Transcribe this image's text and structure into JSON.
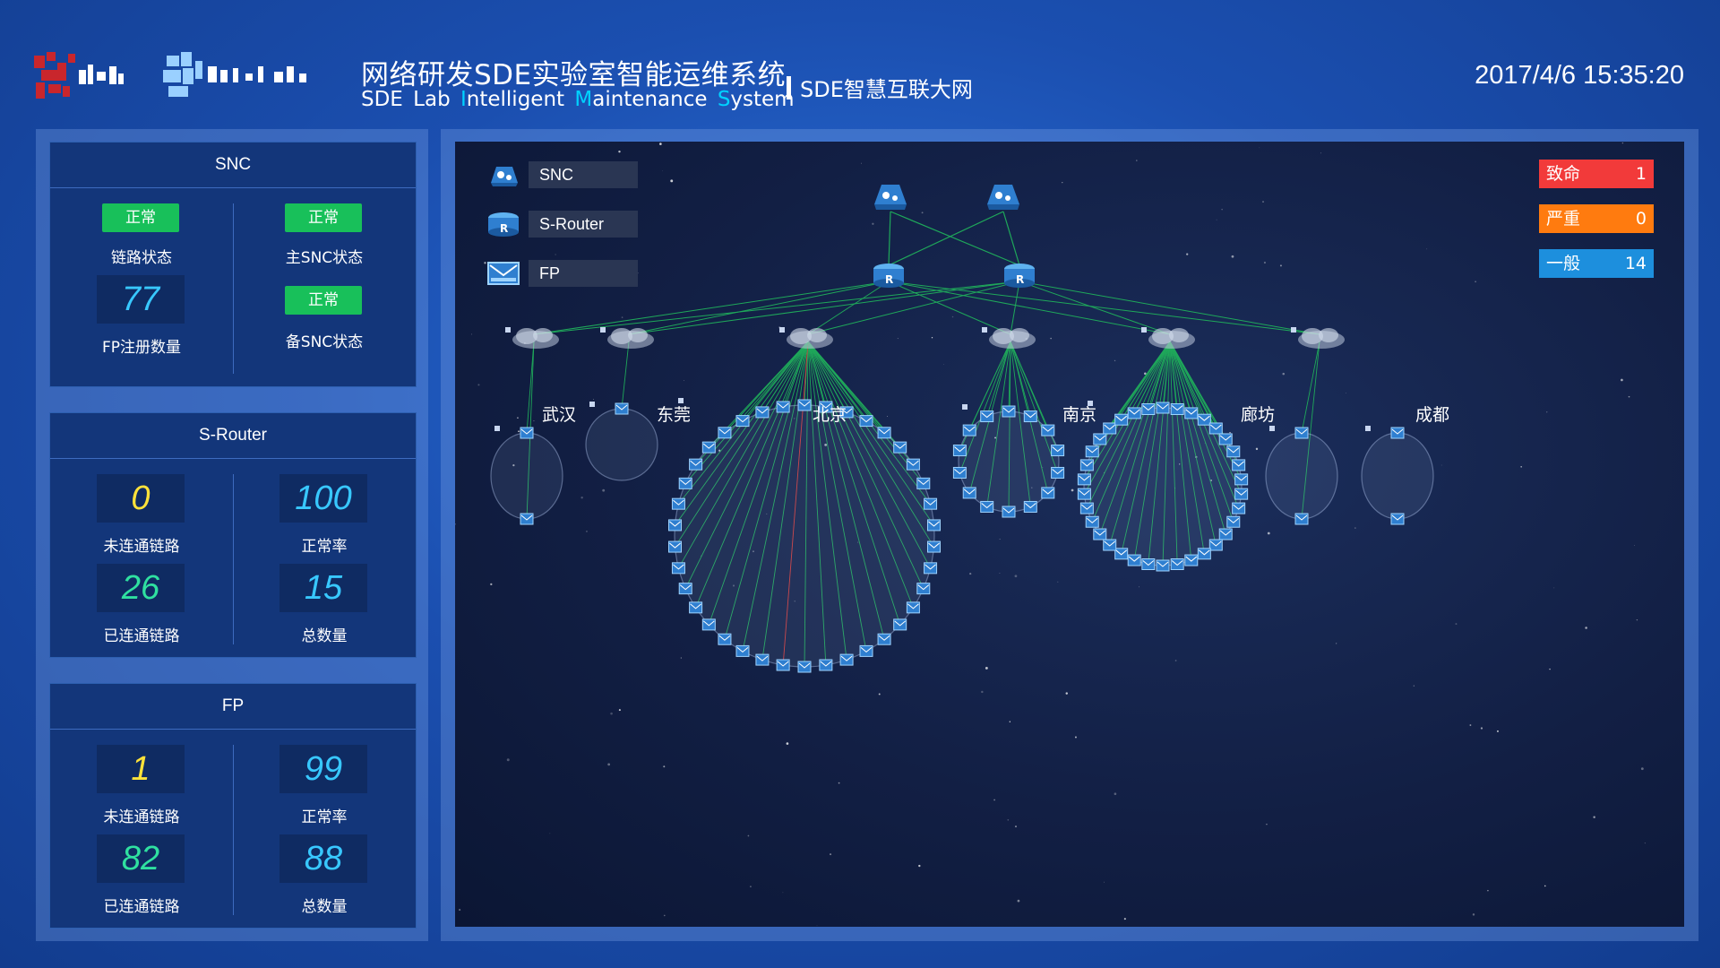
{
  "header": {
    "title_cn": "网络研发SDE实验室智能运维系统",
    "title_en_words": [
      {
        "cap": "",
        "rest": "SDE"
      },
      {
        "cap": "",
        "rest": "Lab"
      },
      {
        "cap": "I",
        "rest": "ntelligent"
      },
      {
        "cap": "M",
        "rest": "aintenance"
      },
      {
        "cap": "S",
        "rest": "ystem"
      }
    ],
    "subtitle": "SDE智慧互联大网",
    "datetime": "2017/4/6 15:35:20"
  },
  "snc_panel": {
    "title": "SNC",
    "link_status_badge": "正常",
    "link_status_label": "链路状态",
    "main_snc_badge": "正常",
    "main_snc_label": "主SNC状态",
    "fp_count": "77",
    "fp_count_label": "FP注册数量",
    "backup_snc_badge": "正常",
    "backup_snc_label": "备SNC状态"
  },
  "srouter_panel": {
    "title": "S-Router",
    "unconnected": "0",
    "unconnected_label": "未连通链路",
    "normal_rate": "100",
    "normal_rate_label": "正常率",
    "connected": "26",
    "connected_label": "已连通链路",
    "total": "15",
    "total_label": "总数量"
  },
  "fp_panel": {
    "title": "FP",
    "unconnected": "1",
    "unconnected_label": "未连通链路",
    "normal_rate": "99",
    "normal_rate_label": "正常率",
    "connected": "82",
    "connected_label": "已连通链路",
    "total": "88",
    "total_label": "总数量"
  },
  "legend": {
    "snc": "SNC",
    "srouter": "S-Router",
    "fp": "FP"
  },
  "alarms": {
    "fatal_label": "致命",
    "fatal_count": "1",
    "severe_label": "严重",
    "severe_count": "0",
    "general_label": "一般",
    "general_count": "14"
  },
  "cities": [
    "武汉",
    "东莞",
    "北京",
    "南京",
    "廊坊",
    "成都"
  ],
  "colors": {
    "normal_green": "#18c05a",
    "fatal_red": "#f23a3a",
    "severe_orange": "#ff7b0f",
    "general_blue": "#1d8fdd",
    "link_green": "#1fa85a",
    "accent_cyan": "#00d2ff"
  }
}
